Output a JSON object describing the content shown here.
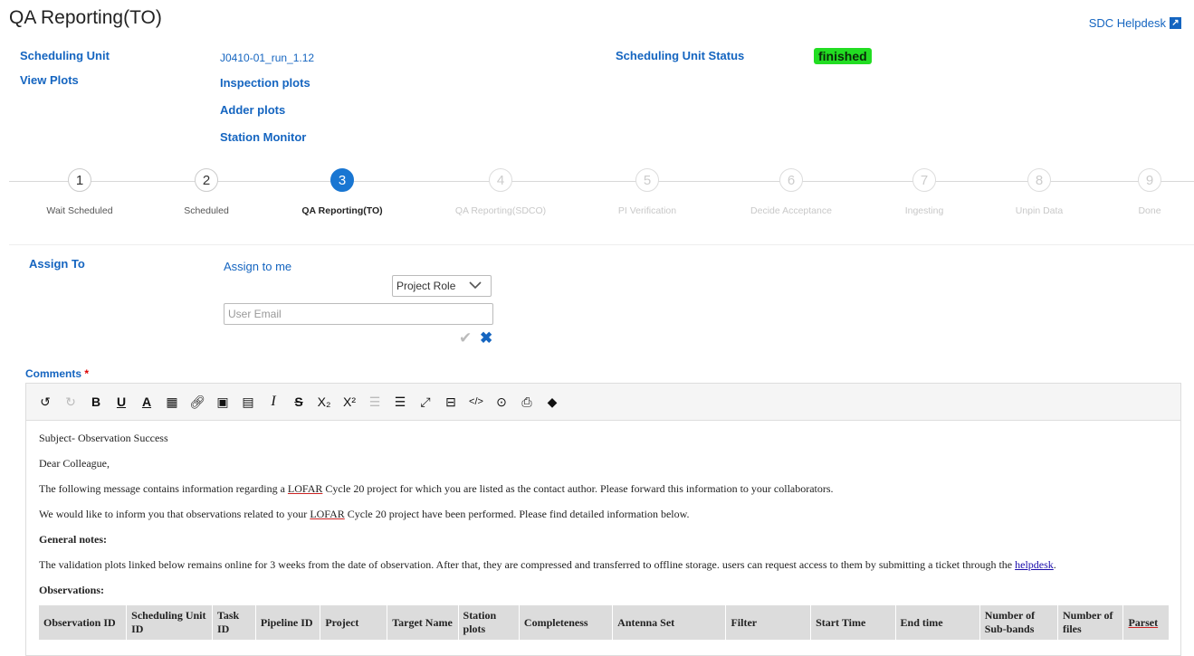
{
  "header": {
    "title": "QA Reporting(TO)",
    "helpdesk": "SDC Helpdesk"
  },
  "info": {
    "scheduling_unit_label": "Scheduling Unit",
    "scheduling_unit_value": "J0410-01_run_1.12",
    "status_label": "Scheduling Unit Status",
    "status_value": "finished",
    "view_plots_label": "View Plots",
    "plot_links": [
      "Inspection plots",
      "Adder plots",
      "Station Monitor"
    ]
  },
  "stepper": {
    "steps": [
      {
        "num": "1",
        "label": "Wait Scheduled"
      },
      {
        "num": "2",
        "label": "Scheduled"
      },
      {
        "num": "3",
        "label": "QA Reporting(TO)"
      },
      {
        "num": "4",
        "label": "QA Reporting(SDCO)"
      },
      {
        "num": "5",
        "label": "PI Verification"
      },
      {
        "num": "6",
        "label": "Decide Acceptance"
      },
      {
        "num": "7",
        "label": "Ingesting"
      },
      {
        "num": "8",
        "label": "Unpin Data"
      },
      {
        "num": "9",
        "label": "Done"
      }
    ],
    "active_index": 2
  },
  "assign": {
    "label": "Assign To",
    "assign_me": "Assign to me",
    "role_select": "Project Role",
    "email_placeholder": "User Email"
  },
  "comments": {
    "label": "Comments",
    "required": "*",
    "toolbar_icons": [
      "undo-icon",
      "redo-icon",
      "bold-icon",
      "underline-icon",
      "font-color-icon",
      "table-icon",
      "link-icon",
      "image-icon",
      "video-icon",
      "italic-icon",
      "strikethrough-icon",
      "subscript-icon",
      "superscript-icon",
      "outdent-icon",
      "indent-icon",
      "fullscreen-icon",
      "show-blocks-icon",
      "code-view-icon",
      "preview-icon",
      "print-icon",
      "remove-format-icon"
    ],
    "body": {
      "subject": "Subject- Observation Success",
      "greeting": "Dear Colleague,",
      "para1_a": "The following message contains information regarding a ",
      "lofar": "LOFAR",
      "para1_b": " Cycle 20 project for which you are listed as the contact author. Please forward this information to your collaborators.",
      "para2_a": "We would like to inform you that observations related to your ",
      "para2_b": " Cycle 20 project have been performed. Please find detailed information below.",
      "general_notes": "General notes:",
      "para3_a": "The validation plots linked below remains online for 3 weeks from the date of observation. After that, they are compressed and transferred to offline storage. users can request access to them by submitting a ticket through the ",
      "helpdesk_link": "helpdesk",
      "para3_b": ".",
      "observations": "Observations:"
    },
    "table_headers": [
      "Observation ID",
      "Scheduling Unit ID",
      "Task ID",
      "Pipeline ID",
      "Project",
      "Target Name",
      "Station plots",
      "Completeness",
      "Antenna Set",
      "Filter",
      "Start Time",
      "End time",
      "Number of Sub-bands",
      "Number of files",
      "Parset"
    ]
  }
}
